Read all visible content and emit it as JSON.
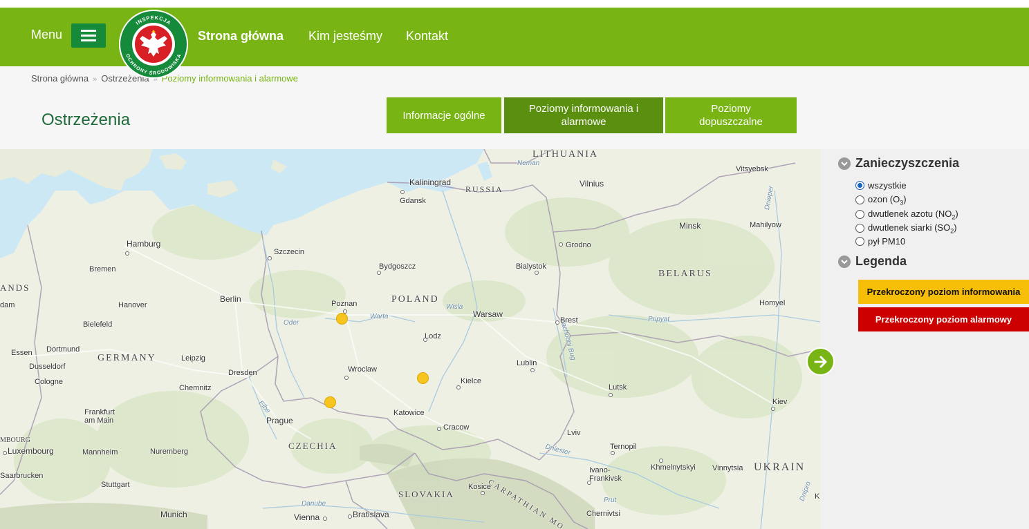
{
  "header": {
    "menu_label": "Menu",
    "logo_text_top": "INSPEKCJA",
    "logo_text_bottom": "OCHRONY ŚRODOWISKA",
    "nav": [
      "Strona główna",
      "Kim jesteśmy",
      "Kontakt"
    ],
    "brand_color": "#78b413"
  },
  "breadcrumb": [
    "Strona główna",
    "Ostrzeżenia",
    "Poziomy informowania i alarmowe"
  ],
  "page_title": "Ostrzeżenia",
  "tabs": [
    {
      "label": "Informacje ogólne",
      "active": false
    },
    {
      "label": "Poziomy informowania i alarmowe",
      "active": true
    },
    {
      "label": "Poziomy dopuszczalne",
      "active": false
    }
  ],
  "map": {
    "countries": [
      "LITHUANIA",
      "RUSSIA",
      "BELARUS",
      "POLAND",
      "GERMANY",
      "CZECHIA",
      "SLOVAKIA",
      "UKRAIN",
      "ANDS",
      "MBOURG"
    ],
    "cities": [
      "Kaliningrad",
      "Vilnius",
      "Vitsyebsk",
      "Gdansk",
      "Minsk",
      "Mahilyow",
      "Hamburg",
      "Szczecin",
      "Grodno",
      "Bremen",
      "Bydgoszcz",
      "Bialystok",
      "Hanover",
      "Berlin",
      "Poznan",
      "Homyel",
      "dam",
      "Bielefeld",
      "Warsaw",
      "Brest",
      "Dortmund",
      "Lodz",
      "Essen",
      "Leipzig",
      "Dusseldorf",
      "Lublin",
      "Cologne",
      "Dresden",
      "Wroclaw",
      "Kielce",
      "Chemnitz",
      "Lutsk",
      "Frankfurt am Main",
      "Kiev",
      "Prague",
      "Katowice",
      "Cracow",
      "Lviv",
      "Luxembourg",
      "Mannheim",
      "Nuremberg",
      "Ternopil",
      "Saarbrucken",
      "Ivano-Frankivsk",
      "Khmelnytskyi",
      "Vinnytsia",
      "Stuttgart",
      "Kosice",
      "Munich",
      "Vienna",
      "Bratislava",
      "Chernivtsi",
      "K"
    ],
    "waters": [
      "Neman",
      "Wisla",
      "Warta",
      "Oder",
      "Pripyat",
      "Dnieper",
      "Elbe",
      "Danube",
      "Prut",
      "Dniester",
      "Zachodni Bug",
      "Dnipro"
    ],
    "region_label": "CARPATHIAN MO",
    "stations": [
      {
        "near": "Poznan",
        "color": "#f7c520"
      },
      {
        "near": "Kielce",
        "color": "#f7c520"
      },
      {
        "near": "Wroclaw",
        "color": "#f7c520"
      }
    ]
  },
  "panel": {
    "pollutants_title": "Zanieczyszczenia",
    "options": [
      {
        "label": "wszystkie",
        "sub": "",
        "suffix": "",
        "checked": true
      },
      {
        "label": "ozon (O",
        "sub": "3",
        "suffix": ")",
        "checked": false
      },
      {
        "label": "dwutlenek azotu (NO",
        "sub": "2",
        "suffix": ")",
        "checked": false
      },
      {
        "label": "dwutlenek siarki (SO",
        "sub": "2",
        "suffix": ")",
        "checked": false
      },
      {
        "label": "pył PM10",
        "sub": "",
        "suffix": "",
        "checked": false
      }
    ],
    "legend_title": "Legenda",
    "legend": [
      {
        "label": "Przekroczony poziom informowania",
        "color": "#f7be08"
      },
      {
        "label": "Przekroczony poziom alarmowy",
        "color": "#cc0000"
      }
    ]
  }
}
